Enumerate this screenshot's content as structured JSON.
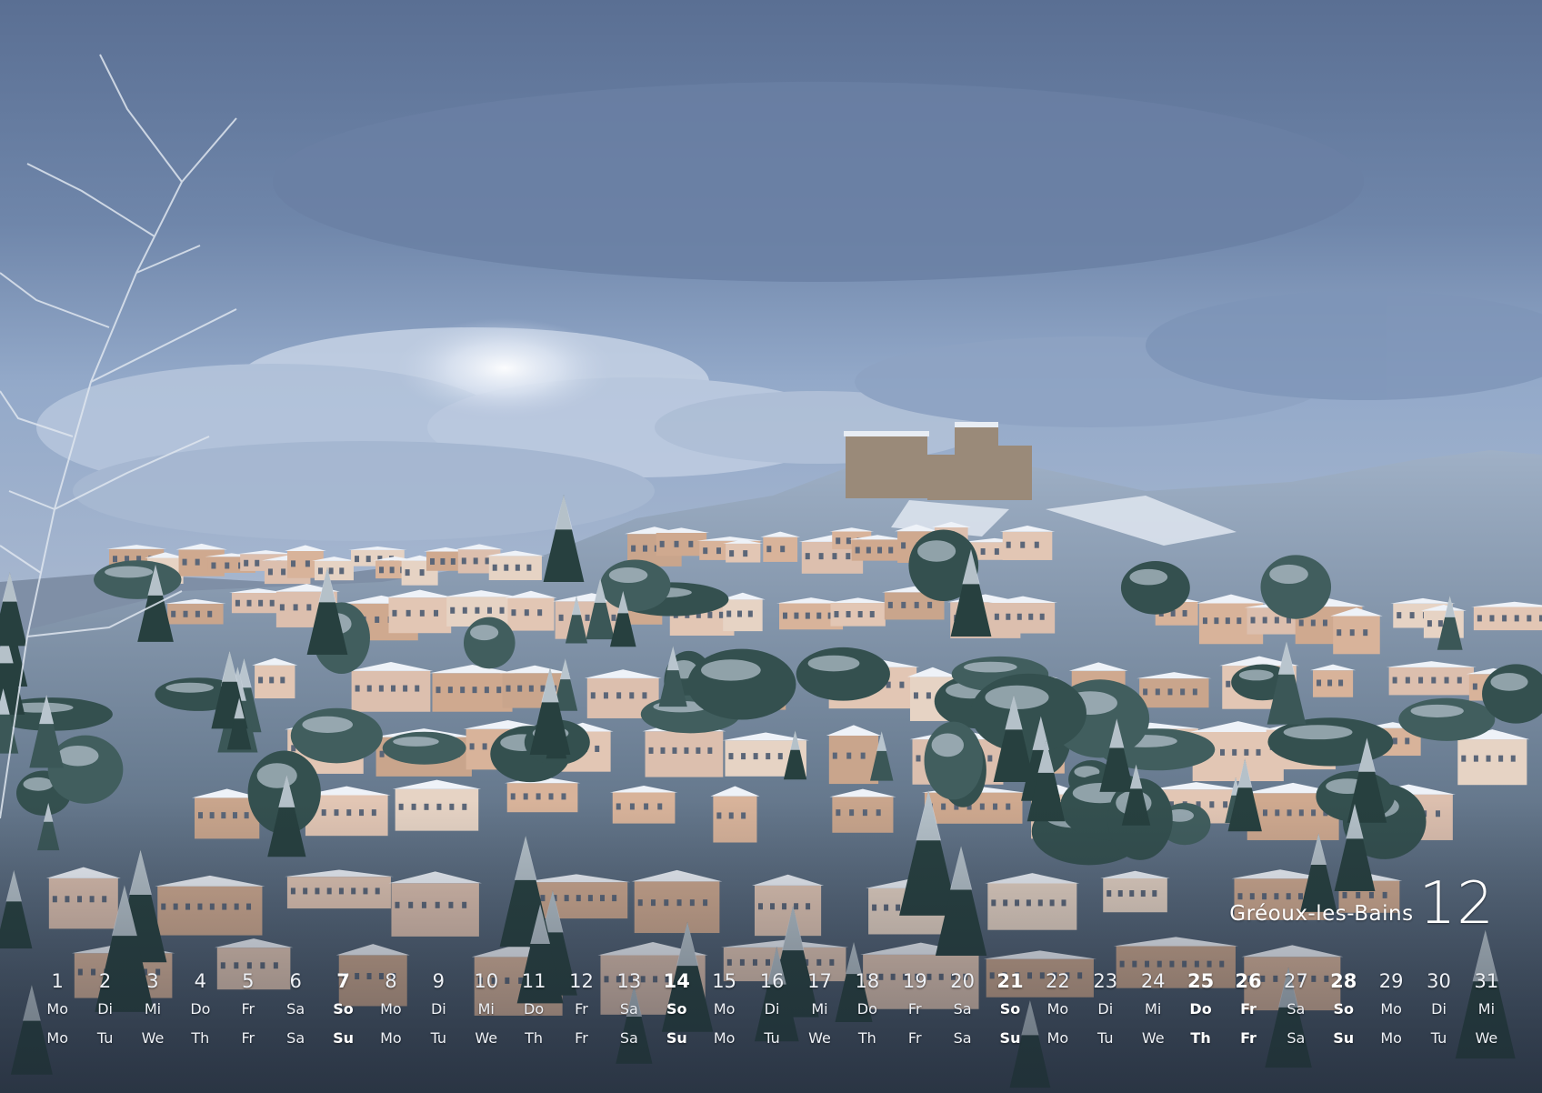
{
  "calendar": {
    "place": "Gréoux-les-Bains",
    "month": "12",
    "days": [
      {
        "n": "1",
        "de": "Mo",
        "en": "Mo",
        "hl": false
      },
      {
        "n": "2",
        "de": "Di",
        "en": "Tu",
        "hl": false
      },
      {
        "n": "3",
        "de": "Mi",
        "en": "We",
        "hl": false
      },
      {
        "n": "4",
        "de": "Do",
        "en": "Th",
        "hl": false
      },
      {
        "n": "5",
        "de": "Fr",
        "en": "Fr",
        "hl": false
      },
      {
        "n": "6",
        "de": "Sa",
        "en": "Sa",
        "hl": false
      },
      {
        "n": "7",
        "de": "So",
        "en": "Su",
        "hl": true
      },
      {
        "n": "8",
        "de": "Mo",
        "en": "Mo",
        "hl": false
      },
      {
        "n": "9",
        "de": "Di",
        "en": "Tu",
        "hl": false
      },
      {
        "n": "10",
        "de": "Mi",
        "en": "We",
        "hl": false
      },
      {
        "n": "11",
        "de": "Do",
        "en": "Th",
        "hl": false
      },
      {
        "n": "12",
        "de": "Fr",
        "en": "Fr",
        "hl": false
      },
      {
        "n": "13",
        "de": "Sa",
        "en": "Sa",
        "hl": false
      },
      {
        "n": "14",
        "de": "So",
        "en": "Su",
        "hl": true
      },
      {
        "n": "15",
        "de": "Mo",
        "en": "Mo",
        "hl": false
      },
      {
        "n": "16",
        "de": "Di",
        "en": "Tu",
        "hl": false
      },
      {
        "n": "17",
        "de": "Mi",
        "en": "We",
        "hl": false
      },
      {
        "n": "18",
        "de": "Do",
        "en": "Th",
        "hl": false
      },
      {
        "n": "19",
        "de": "Fr",
        "en": "Fr",
        "hl": false
      },
      {
        "n": "20",
        "de": "Sa",
        "en": "Sa",
        "hl": false
      },
      {
        "n": "21",
        "de": "So",
        "en": "Su",
        "hl": true
      },
      {
        "n": "22",
        "de": "Mo",
        "en": "Mo",
        "hl": false
      },
      {
        "n": "23",
        "de": "Di",
        "en": "Tu",
        "hl": false
      },
      {
        "n": "24",
        "de": "Mi",
        "en": "We",
        "hl": false
      },
      {
        "n": "25",
        "de": "Do",
        "en": "Th",
        "hl": true
      },
      {
        "n": "26",
        "de": "Fr",
        "en": "Fr",
        "hl": true
      },
      {
        "n": "27",
        "de": "Sa",
        "en": "Sa",
        "hl": false
      },
      {
        "n": "28",
        "de": "So",
        "en": "Su",
        "hl": true
      },
      {
        "n": "29",
        "de": "Mo",
        "en": "Mo",
        "hl": false
      },
      {
        "n": "30",
        "de": "Di",
        "en": "Tu",
        "hl": false
      },
      {
        "n": "31",
        "de": "Mi",
        "en": "We",
        "hl": false
      }
    ]
  },
  "colors": {
    "sky_top": "#5f7497",
    "sky_mid": "#8aa0c2",
    "cloud_light": "#e4ebf6",
    "hill_snow": "#dfe6f0",
    "trees": "#2e4a4a",
    "houses_warm": "#d9b49a",
    "text": "#ffffff"
  }
}
